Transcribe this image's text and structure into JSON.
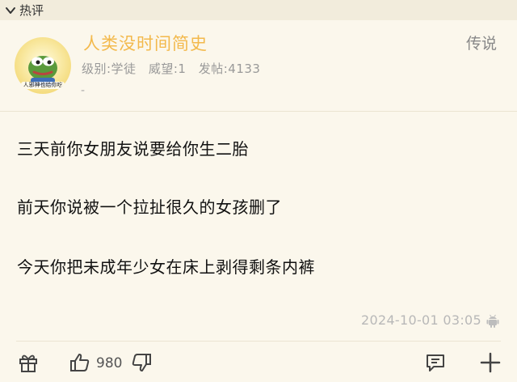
{
  "header": {
    "title": "热评"
  },
  "user": {
    "name": "人类没时间简史",
    "avatar_text": "人邪神也给你吃",
    "level_label": "级别:学徒",
    "prestige_label": "威望:1",
    "posts_label": "发帖:4133",
    "signature": "-",
    "badge": "传说"
  },
  "post": {
    "lines": [
      "三天前你女朋友说要给你生二胎",
      "前天你说被一个拉扯很久的女孩删了",
      "今天你把未成年少女在床上剥得剩条内裤"
    ],
    "time": "2024-10-01 03:05"
  },
  "actions": {
    "like_count": "980"
  },
  "colors": {
    "background": "#fbf7ec",
    "header_bg": "#f2ecdc",
    "username": "#f3b94c"
  }
}
